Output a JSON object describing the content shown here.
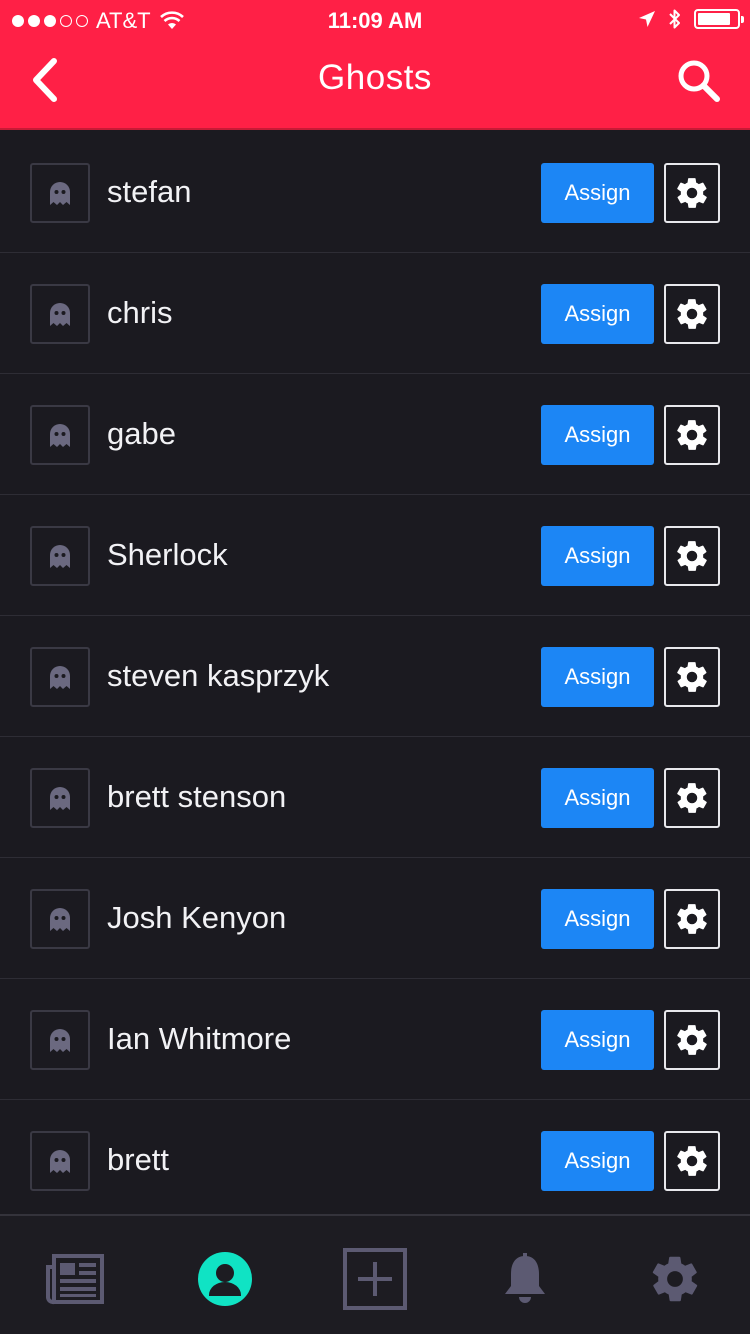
{
  "status_bar": {
    "carrier": "AT&T",
    "signal_bars_filled": 3,
    "signal_bars_total": 5,
    "time": "11:09 AM",
    "battery_level": 0.85
  },
  "nav": {
    "title": "Ghosts",
    "back_icon": "chevron-left-icon",
    "search_icon": "search-icon"
  },
  "ghosts": [
    {
      "name": "stefan",
      "assign_label": "Assign"
    },
    {
      "name": "chris",
      "assign_label": "Assign"
    },
    {
      "name": "gabe",
      "assign_label": "Assign"
    },
    {
      "name": "Sherlock",
      "assign_label": "Assign"
    },
    {
      "name": "steven kasprzyk",
      "assign_label": "Assign"
    },
    {
      "name": "brett stenson",
      "assign_label": "Assign"
    },
    {
      "name": "Josh Kenyon",
      "assign_label": "Assign"
    },
    {
      "name": "Ian Whitmore",
      "assign_label": "Assign"
    },
    {
      "name": "brett",
      "assign_label": "Assign"
    }
  ],
  "tabbar": {
    "tabs": [
      {
        "icon": "newspaper-icon",
        "active": false
      },
      {
        "icon": "profile-icon",
        "active": true
      },
      {
        "icon": "add-icon",
        "active": false
      },
      {
        "icon": "bell-icon",
        "active": false
      },
      {
        "icon": "gear-icon",
        "active": false
      }
    ]
  },
  "colors": {
    "header": "#ff2046",
    "background": "#1b1a20",
    "assign_button": "#1c86f5",
    "active_tab": "#10e3c4",
    "inactive_tab": "#5c5a72",
    "ghost_icon": "#6b6980"
  }
}
